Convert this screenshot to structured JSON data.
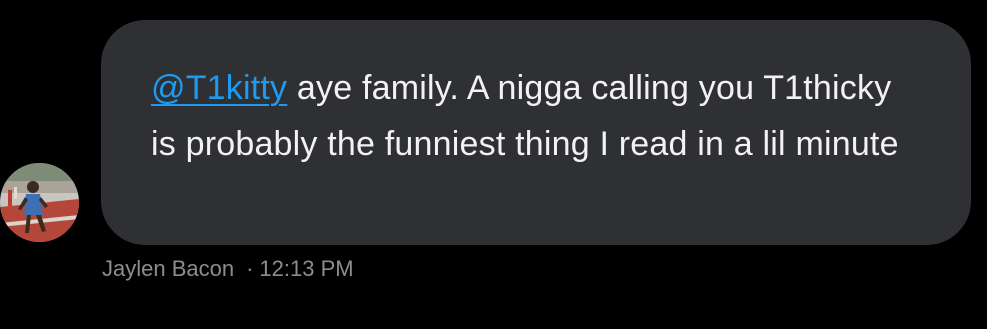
{
  "message": {
    "mention": "@T1kitty",
    "text": " aye family. A nigga calling you T1thicky is probably the funniest thing I read in a lil minute"
  },
  "sender": {
    "name": "Jaylen Bacon",
    "avatar_icon": "runner-photo-avatar"
  },
  "meta": {
    "separator": "·",
    "time": "12:13 PM"
  },
  "colors": {
    "background": "#000000",
    "bubble": "#2f3033",
    "message_text": "#f2f2f2",
    "mention": "#1d9bf0",
    "meta_text": "#8b8d91"
  }
}
